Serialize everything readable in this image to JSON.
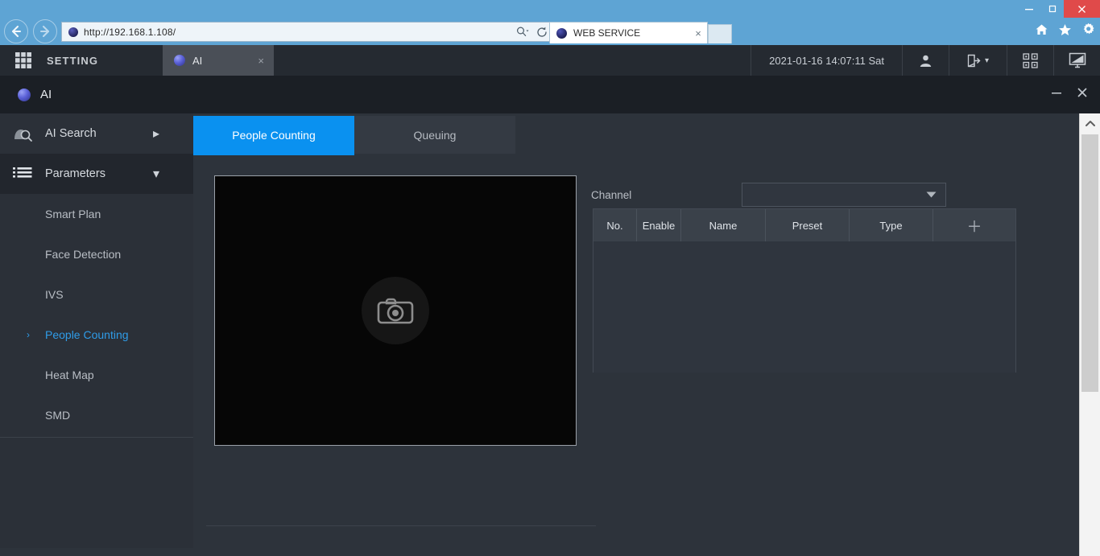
{
  "browser": {
    "address_url": "http://192.168.1.108/",
    "search_icon": "search-dropdown-icon",
    "refresh_icon": "refresh-icon",
    "tab_title": "WEB SERVICE",
    "tab_close": "×",
    "home_icon": "home-icon",
    "favorites_icon": "star-icon",
    "tools_icon": "gear-icon",
    "win_minimize": "–",
    "win_restore": "❐",
    "win_close": "✕"
  },
  "topbar": {
    "launcher_icon": "grid-apps-icon",
    "setting_label": "SETTING",
    "ai_tab_label": "AI",
    "ai_tab_close": "×",
    "datetime": "2021-01-16 14:07:11 Sat",
    "user_icon": "user-account-icon",
    "logout_icon": "logout-icon",
    "logout_caret": "▾",
    "qrcode_icon": "qr-code-icon",
    "display_icon": "monitor-display-icon"
  },
  "window": {
    "title": "AI",
    "minimize": "–",
    "close": "✕"
  },
  "sidebar": {
    "heads": [
      {
        "label": "AI Search",
        "icon": "ai-search-icon",
        "chevron": "▸",
        "active": false
      },
      {
        "label": "Parameters",
        "icon": "parameters-list-icon",
        "chevron": "▾",
        "active": true
      }
    ],
    "items": [
      {
        "label": "Smart Plan",
        "active": false
      },
      {
        "label": "Face Detection",
        "active": false
      },
      {
        "label": "IVS",
        "active": false
      },
      {
        "label": "People Counting",
        "active": true,
        "chevron": "›"
      },
      {
        "label": "Heat Map",
        "active": false
      },
      {
        "label": "SMD",
        "active": false
      }
    ]
  },
  "main": {
    "tabs": [
      {
        "label": "People Counting",
        "active": true
      },
      {
        "label": "Queuing",
        "active": false
      }
    ],
    "video_placeholder_icon": "camera-no-video-icon",
    "channel": {
      "label": "Channel",
      "value": "",
      "placeholder": "",
      "caret_icon": "chevron-down-icon"
    },
    "table": {
      "columns": [
        "No.",
        "Enable",
        "Name",
        "Preset",
        "Type"
      ],
      "add_icon": "＋",
      "rows": []
    }
  },
  "scrollbar": {
    "up_arrow": "⌃"
  },
  "colors": {
    "accent_blue": "#0a91f0",
    "chrome_blue": "#5ea4d4",
    "panel_dark": "#2d333b",
    "sidebar_dark": "#2b3038",
    "close_red": "#e04a4a"
  }
}
